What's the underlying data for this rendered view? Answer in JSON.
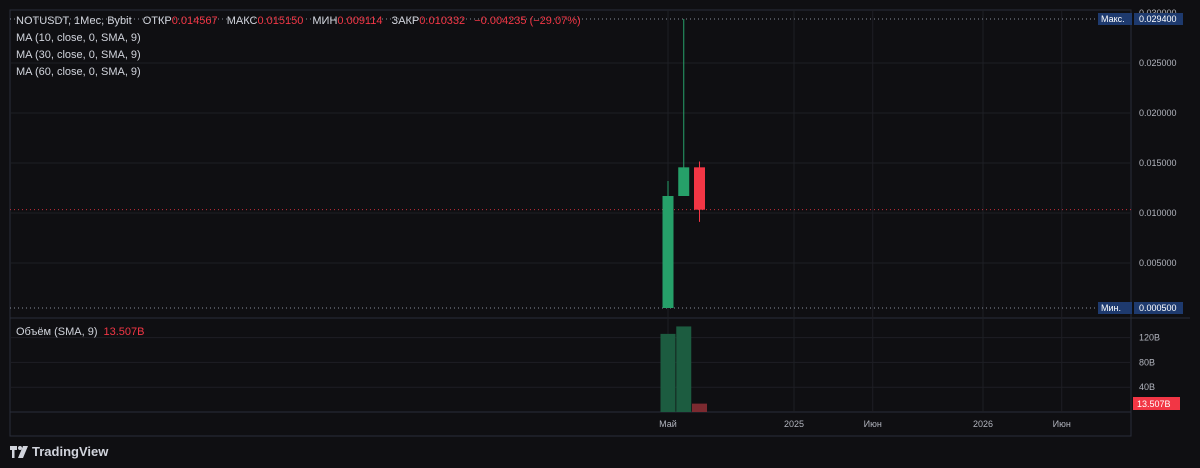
{
  "legend": {
    "symbol": "NOTUSDT, 1Мес, Bybit",
    "open_label": "ОТКР",
    "open": "0.014567",
    "high_label": "МАКС",
    "high": "0.015150",
    "low_label": "МИН",
    "low": "0.009114",
    "close_label": "ЗАКР",
    "close": "0.010332",
    "change": "−0.004235 (−29.07%)"
  },
  "indicators": [
    "MA (10, close, 0, SMA, 9)",
    "MA (30, close, 0, SMA, 9)",
    "MA (60, close, 0, SMA, 9)"
  ],
  "volume_legend": {
    "label": "Объём (SMA, 9)",
    "value": "13.507B"
  },
  "brand": "TradingView",
  "colors": {
    "up": "#26a069",
    "down": "#f23645",
    "vol_up": "#1c5c40",
    "vol_down": "#7c2a30",
    "tag_bg": "#1e3a6e",
    "grid": "#1e1f24",
    "line_dotted": "#e0a060"
  },
  "chart_data": {
    "type": "candlestick",
    "symbol": "NOTUSDT",
    "interval": "1Мес",
    "exchange": "Bybit",
    "candles": [
      {
        "period": "2024-05",
        "open": 0.0005,
        "high": 0.0132,
        "low": 0.0005,
        "close": 0.0117
      },
      {
        "period": "2024-06",
        "open": 0.0117,
        "high": 0.0294,
        "low": 0.0117,
        "close": 0.014567
      },
      {
        "period": "2024-07",
        "open": 0.014567,
        "high": 0.01515,
        "low": 0.009114,
        "close": 0.010332
      }
    ],
    "volume": [
      {
        "period": "2024-05",
        "value": 126,
        "direction": "up"
      },
      {
        "period": "2024-06",
        "value": 138,
        "direction": "up"
      },
      {
        "period": "2024-07",
        "value": 13.507,
        "direction": "down"
      }
    ],
    "price_axis": {
      "ticks": [
        0.025,
        0.02,
        0.015,
        0.01,
        0.005
      ],
      "tick_labels": [
        "0.025000",
        "0.020000",
        "0.015000",
        "0.010000",
        "0.005000"
      ],
      "top_partial_label": "0.030000",
      "range": [
        0,
        0.0305
      ]
    },
    "volume_axis": {
      "ticks": [
        120,
        80,
        40
      ],
      "tick_labels": [
        "120B",
        "80B",
        "40B"
      ],
      "range": [
        0,
        150
      ]
    },
    "time_axis": {
      "labels": [
        {
          "text": "Май",
          "period": "2024-05"
        },
        {
          "text": "2025",
          "period": "2025-01"
        },
        {
          "text": "Июн",
          "period": "2025-06"
        },
        {
          "text": "2026",
          "period": "2026-01"
        },
        {
          "text": "Июн",
          "period": "2026-06"
        }
      ]
    },
    "high_marker": {
      "label": "Макс.",
      "value": "0.029400"
    },
    "low_marker": {
      "label": "Мин.",
      "value": "0.000500"
    },
    "last_price": 0.010332,
    "volume_tag": "13.507B",
    "grid": true
  }
}
